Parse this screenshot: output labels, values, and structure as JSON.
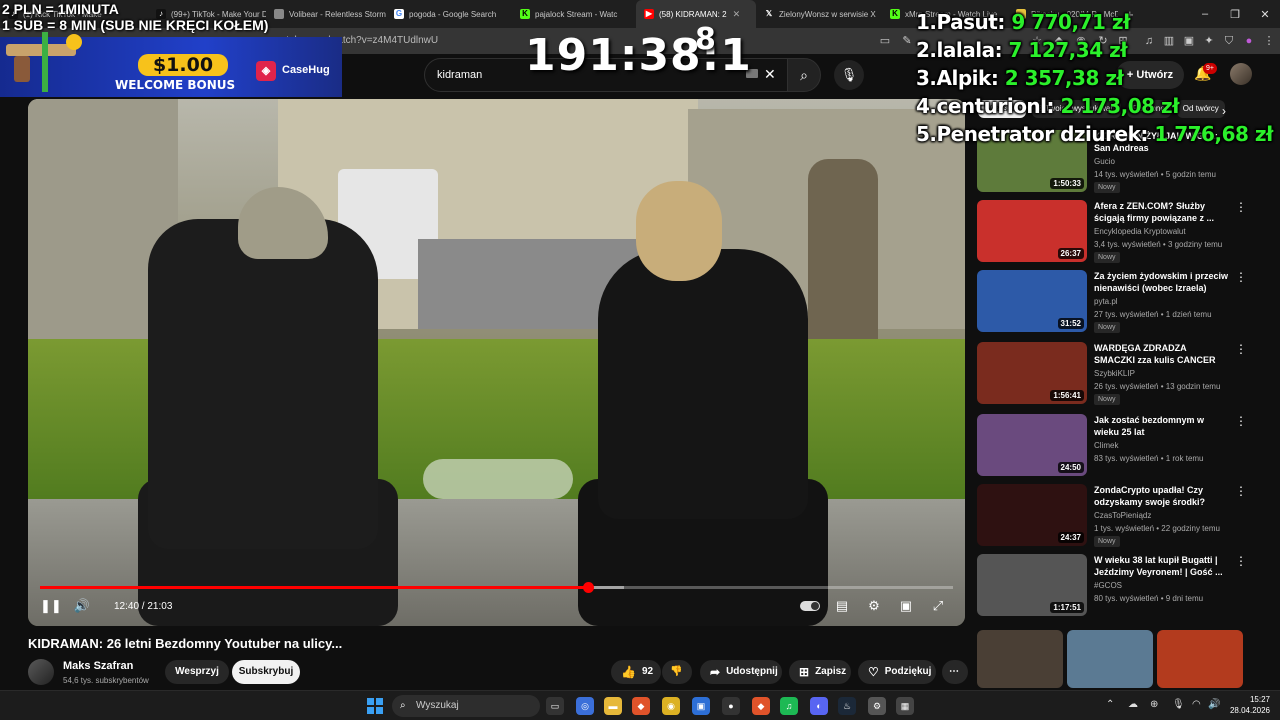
{
  "browser": {
    "tabs": [
      {
        "label": "(1) Kick TikTok - Make",
        "icon": "tiktok-icon"
      },
      {
        "label": "(99+) TikTok - Make Your D",
        "icon": "tiktok-icon"
      },
      {
        "label": "Volibear - Relentless Storm",
        "icon": "page-icon"
      },
      {
        "label": "pogoda - Google Search",
        "icon": "google-icon"
      },
      {
        "label": "pajalock Stream - Watc",
        "icon": "kick-icon"
      },
      {
        "label": "(58) KIDRAMAN: 2",
        "icon": "youtube-icon"
      },
      {
        "label": "ZielonyWonsz w serwisie X",
        "icon": "x-icon"
      },
      {
        "label": "xMrn Stream - Watch Live",
        "icon": "kick-icon"
      },
      {
        "label": "Pikachu - 020/M-P - McDo",
        "icon": "page-icon"
      }
    ],
    "url": "youtube.com/watch?v=z4M4TUdlnwU"
  },
  "youtube": {
    "search_query": "kidraman",
    "create_label": "Utwórz",
    "notifications_badge": "9+"
  },
  "video": {
    "current_time": "12:40 / 21:03",
    "progress_fraction": 0.6,
    "buffered_fraction": 0.64,
    "title": "KIDRAMAN: 26 letni Bezdomny Youtuber na ulicy...",
    "channel_name": "Maks Szafran",
    "channel_subs": "54,6 tys. subskrybentów",
    "join_label": "Wesprzyj",
    "subscribe_label": "Subskrybuj",
    "likes": "92",
    "share_label": "Udostępnij",
    "save_label": "Zapisz",
    "thanks_label": "Podziękuj"
  },
  "sidebar": {
    "chips": [
      "Wszystkie",
      "Z Twoich wyszukiwań",
      "Podobne",
      "Od twórcy"
    ],
    "recommendations": [
      {
        "title": "KIDRAMAN ŻYŁ JAK W GTA: San Andreas",
        "channel": "Gucio",
        "meta": "14 tys. wyświetleń • 5 godzin temu",
        "badge": "Nowy",
        "duration": "1:50:33",
        "thumb_color": "#5e7b3b"
      },
      {
        "title": "Afera z ZEN.COM? Służby ścigają firmy powiązane z ...",
        "channel": "Encyklopedia Kryptowalut",
        "meta": "3,4 tys. wyświetleń • 3 godziny temu",
        "badge": "Nowy",
        "duration": "26:37",
        "thumb_color": "#c9302c"
      },
      {
        "title": "Za życiem żydowskim i przeciw nienawiści (wobec Izraela)",
        "channel": "pyta.pl",
        "meta": "27 tys. wyświetleń • 1 dzień temu",
        "badge": "Nowy",
        "duration": "31:52",
        "thumb_color": "#2d5aa8"
      },
      {
        "title": "WARDĘGA ZDRADZA SMACZKI zza kulis CANCER FIGHTERS i ...",
        "channel": "SzybkiKLIP",
        "meta": "26 tys. wyświetleń • 13 godzin temu",
        "badge": "Nowy",
        "duration": "1:56:41",
        "thumb_color": "#7a2b1e"
      },
      {
        "title": "Jak zostać bezdomnym w wieku 25 lat",
        "channel": "Climek",
        "meta": "83 tys. wyświetleń • 1 rok temu",
        "badge": "",
        "duration": "24:50",
        "thumb_color": "#6a4a7e"
      },
      {
        "title": "ZondaCrypto upadła! Czy odzyskamy swoje środki?",
        "channel": "CzasToPieniądz",
        "meta": "1 tys. wyświetleń • 22 godziny temu",
        "badge": "Nowy",
        "duration": "24:37",
        "thumb_color": "#2e1111"
      },
      {
        "title": "W wieku 38 lat kupił Bugatti | Jeździmy Veyronem! | Gość ...",
        "channel": "#GCOS",
        "meta": "80 tys. wyświetleń • 9 dni temu",
        "badge": "",
        "duration": "1:17:51",
        "thumb_color": "#555555"
      }
    ],
    "shorts_colors": [
      "#4a3f35",
      "#5b7a93",
      "#b33b1e"
    ]
  },
  "overlays": {
    "donation_rule_line1": "2 PLN = 1MINUTA",
    "donation_rule_line2": "1 SUB = 8 MIN (SUB NIE KRĘCI KOŁEM)",
    "timer": "191:38:1",
    "timer_next_digit": "8",
    "banner_price": "$1.00",
    "banner_text": "WELCOME BONUS",
    "banner_brand": "CaseHug",
    "leaderboard": [
      {
        "rank": "1.",
        "name": "Pasut:",
        "amount": "9 770,71 zł"
      },
      {
        "rank": "2.",
        "name": "lalala:",
        "amount": "7 127,34 zł"
      },
      {
        "rank": "3.",
        "name": "Alpik:",
        "amount": "2 357,38 zł"
      },
      {
        "rank": "4.",
        "name": "centurionl:",
        "amount": "2 173,08 zł"
      },
      {
        "rank": "5.",
        "name": "Penetrator dziurek:",
        "amount": "1 776,68 zł"
      }
    ]
  },
  "taskbar": {
    "search_placeholder": "Wyszukaj",
    "time": "15:27",
    "date": "28.04.2026"
  },
  "colors": {
    "accent_red": "#ff0000",
    "leaderboard_green": "#2bf02b",
    "banner_gold": "#f7c21b"
  }
}
